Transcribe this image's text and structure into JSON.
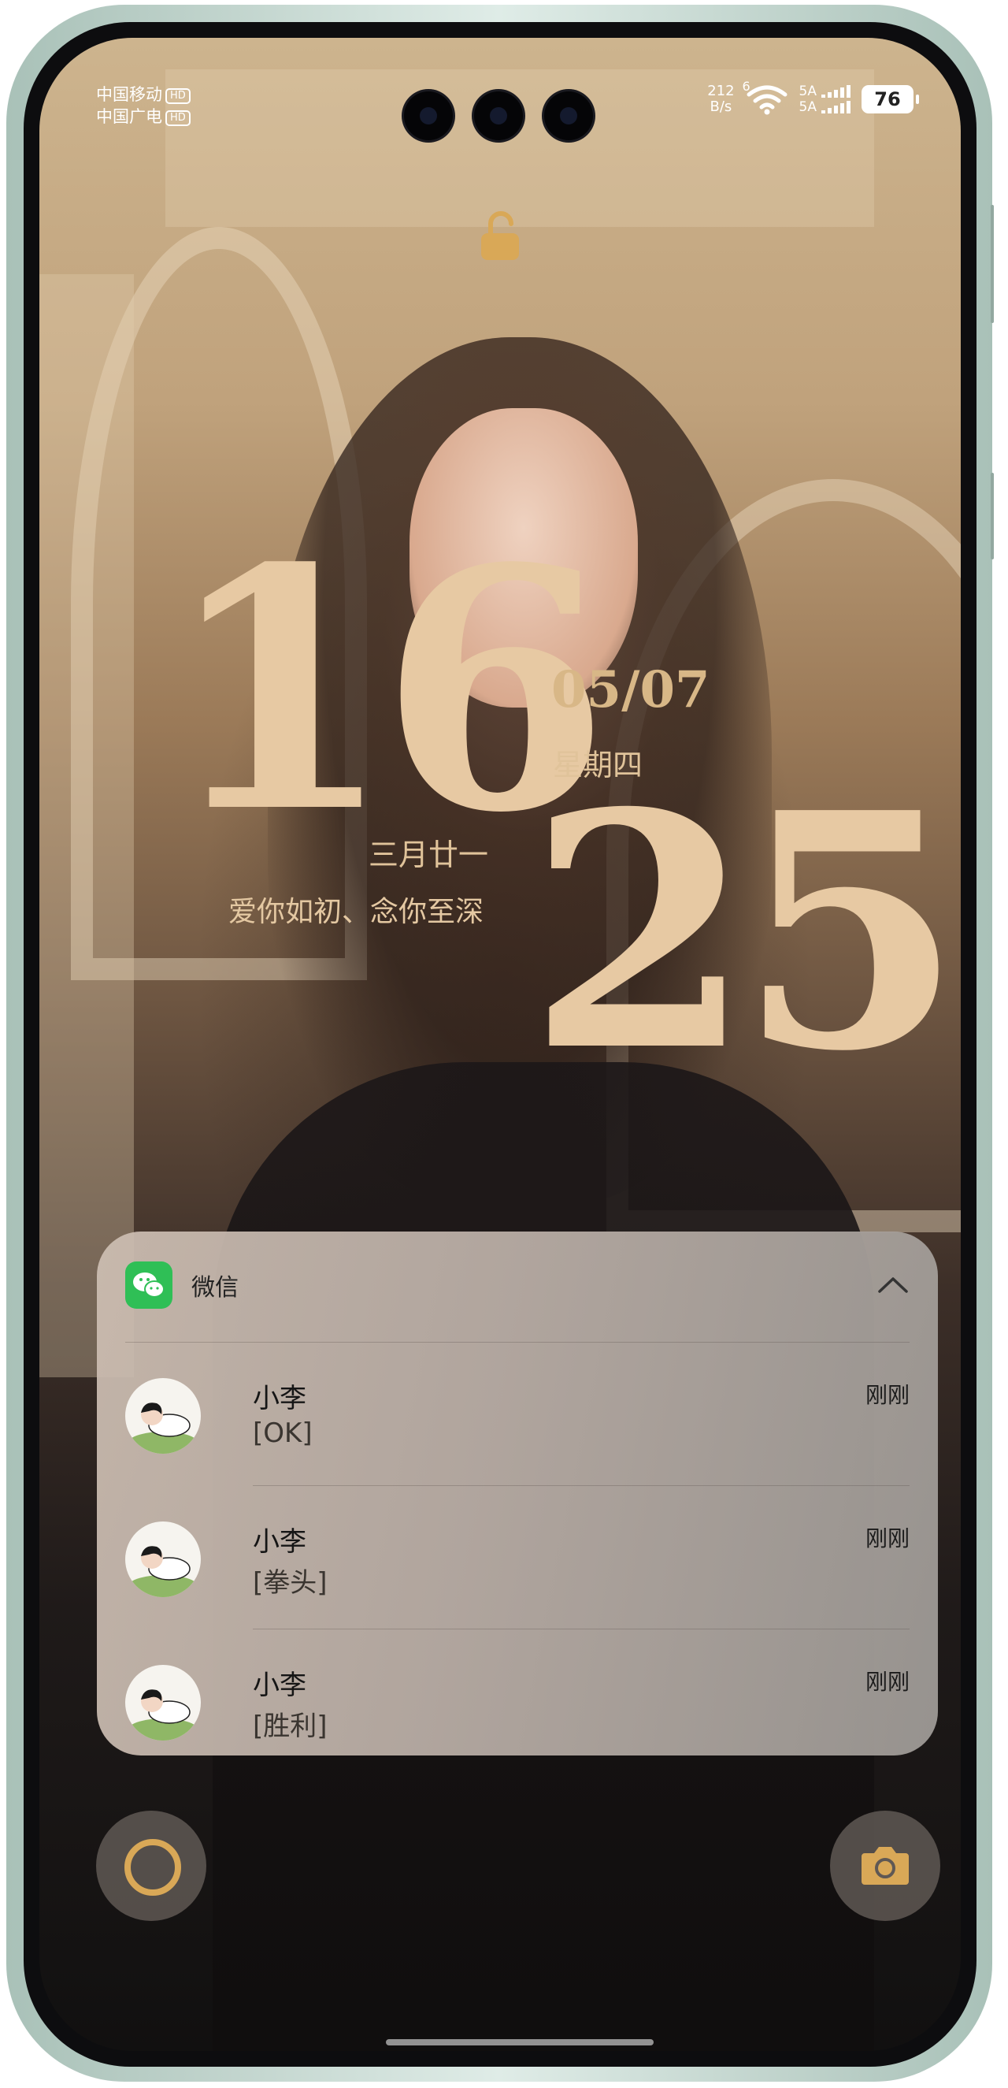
{
  "status_bar": {
    "carrier1": "中国移动",
    "carrier2": "中国广电",
    "hd_badge": "HD",
    "net_speed_value": "212",
    "net_speed_unit": "B/s",
    "wifi_label": "6",
    "sim1_label": "5A",
    "sim2_label": "5A",
    "battery": "76",
    "icons": [
      "wifi-icon",
      "signal-icon",
      "battery-icon"
    ]
  },
  "lock_icon": "unlock-icon",
  "clock": {
    "hour": "16",
    "minute": "25",
    "date": "05/07",
    "weekday": "星期四",
    "lunar_date": "三月廿一",
    "motto": "爱你如初、念你至深",
    "color": "#e7c9a3"
  },
  "notification": {
    "app_name": "微信",
    "app_icon": "wechat-icon",
    "app_color": "#2fbf56",
    "collapse_icon": "chevron-up-icon",
    "messages": [
      {
        "sender": "小李",
        "text": "[OK]",
        "time": "刚刚"
      },
      {
        "sender": "小李",
        "text": "[拳头]",
        "time": "刚刚"
      },
      {
        "sender": "小李",
        "text": "[胜利]",
        "time": "刚刚"
      }
    ]
  },
  "quick_actions": {
    "left_icon": "ring-shortcut-icon",
    "right_icon": "camera-icon",
    "accent": "#d9a857"
  }
}
